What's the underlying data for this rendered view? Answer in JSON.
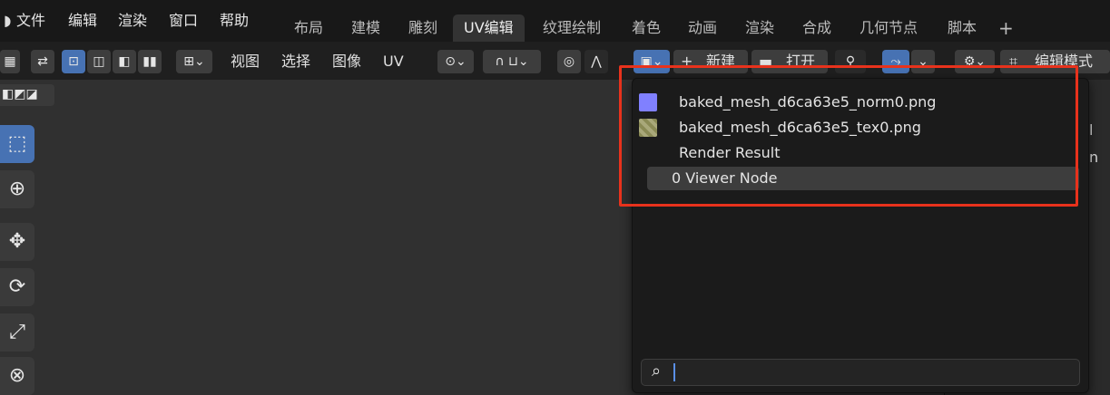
{
  "menubar": {
    "items": [
      "文件",
      "编辑",
      "渲染",
      "窗口",
      "帮助"
    ]
  },
  "workspaces": [
    "布局",
    "建模",
    "雕刻",
    "UV编辑",
    "纹理绘制",
    "着色",
    "动画",
    "渲染",
    "合成",
    "几何节点",
    "脚本"
  ],
  "workspace_add": "+",
  "header": {
    "menus": [
      "视图",
      "选择",
      "图像",
      "UV"
    ],
    "new_label": "新建",
    "open_label": "打开",
    "mode_label": "编辑模式"
  },
  "dropdown": {
    "items": [
      {
        "label": "baked_mesh_d6ca63e5_norm0.png",
        "thumb_color": "#8080ff"
      },
      {
        "label": "baked_mesh_d6ca63e5_tex0.png",
        "thumb_color": "#8a8a55"
      },
      {
        "label": "Render Result",
        "thumb_color": ""
      },
      {
        "label": "0 Viewer Node",
        "thumb_color": ""
      }
    ],
    "search_value": ""
  },
  "side_fragments": [
    "l",
    "n"
  ],
  "colors": {
    "highlight": "#e8321c",
    "selected": "#4772b3"
  }
}
